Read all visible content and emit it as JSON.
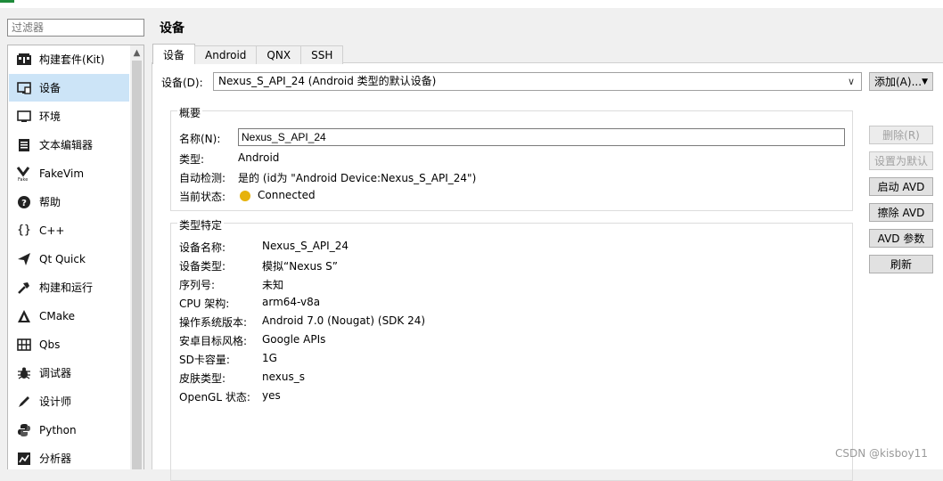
{
  "filter": {
    "placeholder": "过滤器"
  },
  "sidebar": {
    "items": [
      {
        "label": "构建套件(Kit)",
        "icon": "kit-icon"
      },
      {
        "label": "设备",
        "icon": "monitor-icon"
      },
      {
        "label": "环境",
        "icon": "monitor-icon"
      },
      {
        "label": "文本编辑器",
        "icon": "text-editor-icon"
      },
      {
        "label": "FakeVim",
        "icon": "fakevim-icon"
      },
      {
        "label": "帮助",
        "icon": "help-icon"
      },
      {
        "label": "C++",
        "icon": "braces-icon"
      },
      {
        "label": "Qt Quick",
        "icon": "paper-plane-icon"
      },
      {
        "label": "构建和运行",
        "icon": "hammer-icon"
      },
      {
        "label": "CMake",
        "icon": "cmake-icon"
      },
      {
        "label": "Qbs",
        "icon": "qbs-icon"
      },
      {
        "label": "调试器",
        "icon": "bug-icon"
      },
      {
        "label": "设计师",
        "icon": "pencil-icon"
      },
      {
        "label": "Python",
        "icon": "python-icon"
      },
      {
        "label": "分析器",
        "icon": "analyzer-icon"
      }
    ],
    "selected_index": 1
  },
  "page": {
    "title": "设备"
  },
  "tabs": [
    "设备",
    "Android",
    "QNX",
    "SSH"
  ],
  "device": {
    "label": "设备(D):",
    "selected": "Nexus_S_API_24 (Android 类型的默认设备)",
    "add_button": "添加(A)..."
  },
  "summary": {
    "title": "概要",
    "name_label": "名称(N):",
    "name_value": "Nexus_S_API_24",
    "type_label": "类型:",
    "type_value": "Android",
    "autodetect_label": "自动检测:",
    "autodetect_value": "是的 (id为 \"Android Device:Nexus_S_API_24\")",
    "state_label": "当前状态:",
    "state_value": "Connected",
    "state_color": "#e6b20c"
  },
  "specific": {
    "title": "类型特定",
    "rows": [
      {
        "label": "设备名称:",
        "value": "Nexus_S_API_24"
      },
      {
        "label": "设备类型:",
        "value": "模拟“Nexus S”"
      },
      {
        "label": "序列号:",
        "value": "未知"
      },
      {
        "label": "CPU 架构:",
        "value": "arm64-v8a"
      },
      {
        "label": "操作系统版本:",
        "value": "Android 7.0 (Nougat) (SDK 24)"
      },
      {
        "label": "安卓目标风格:",
        "value": "Google APIs"
      },
      {
        "label": "SD卡容量:",
        "value": "1G"
      },
      {
        "label": "皮肤类型:",
        "value": "nexus_s"
      },
      {
        "label": "OpenGL 状态:",
        "value": "yes"
      }
    ]
  },
  "buttons": [
    {
      "label": "删除(R)",
      "enabled": false
    },
    {
      "label": "设置为默认",
      "enabled": false
    },
    {
      "label": "启动 AVD",
      "enabled": true
    },
    {
      "label": "擦除 AVD",
      "enabled": true
    },
    {
      "label": "AVD 参数",
      "enabled": true
    },
    {
      "label": "刷新",
      "enabled": true
    }
  ],
  "watermark": "CSDN @kisboy11"
}
